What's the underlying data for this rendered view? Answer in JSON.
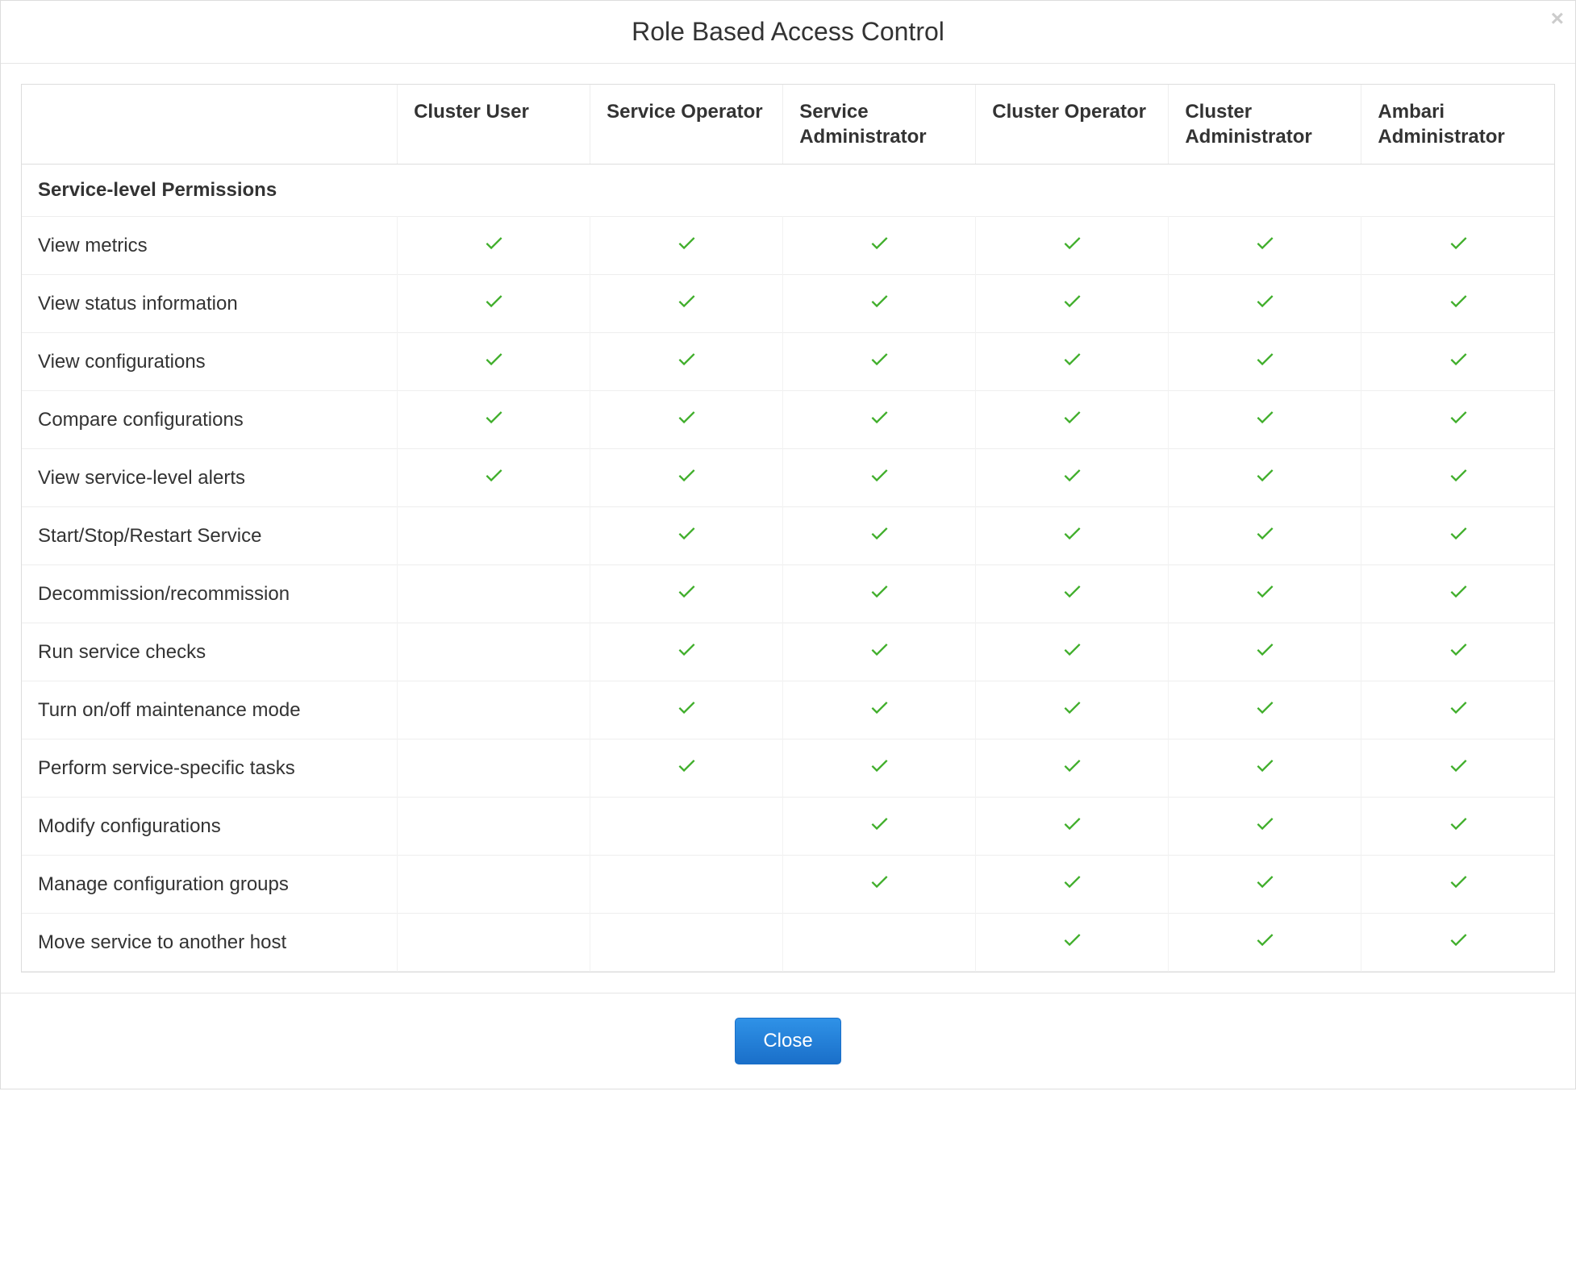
{
  "modal": {
    "title": "Role Based Access Control",
    "close_icon": "×",
    "close_button": "Close"
  },
  "columns": [
    "Cluster User",
    "Service Operator",
    "Service Administrator",
    "Cluster Operator",
    "Cluster Administrator",
    "Ambari Administrator"
  ],
  "sections": [
    {
      "title": "Service-level Permissions",
      "rows": [
        {
          "label": "View metrics",
          "perms": [
            true,
            true,
            true,
            true,
            true,
            true
          ]
        },
        {
          "label": "View status information",
          "perms": [
            true,
            true,
            true,
            true,
            true,
            true
          ]
        },
        {
          "label": "View configurations",
          "perms": [
            true,
            true,
            true,
            true,
            true,
            true
          ]
        },
        {
          "label": "Compare configurations",
          "perms": [
            true,
            true,
            true,
            true,
            true,
            true
          ]
        },
        {
          "label": "View service-level alerts",
          "perms": [
            true,
            true,
            true,
            true,
            true,
            true
          ]
        },
        {
          "label": "Start/Stop/Restart Service",
          "perms": [
            false,
            true,
            true,
            true,
            true,
            true
          ]
        },
        {
          "label": "Decommission/recommission",
          "perms": [
            false,
            true,
            true,
            true,
            true,
            true
          ]
        },
        {
          "label": "Run service checks",
          "perms": [
            false,
            true,
            true,
            true,
            true,
            true
          ]
        },
        {
          "label": "Turn on/off maintenance mode",
          "perms": [
            false,
            true,
            true,
            true,
            true,
            true
          ]
        },
        {
          "label": "Perform service-specific tasks",
          "perms": [
            false,
            true,
            true,
            true,
            true,
            true
          ]
        },
        {
          "label": "Modify configurations",
          "perms": [
            false,
            false,
            true,
            true,
            true,
            true
          ]
        },
        {
          "label": "Manage configuration groups",
          "perms": [
            false,
            false,
            true,
            true,
            true,
            true
          ]
        },
        {
          "label": "Move service to another host",
          "perms": [
            false,
            false,
            false,
            true,
            true,
            true
          ]
        }
      ]
    }
  ]
}
